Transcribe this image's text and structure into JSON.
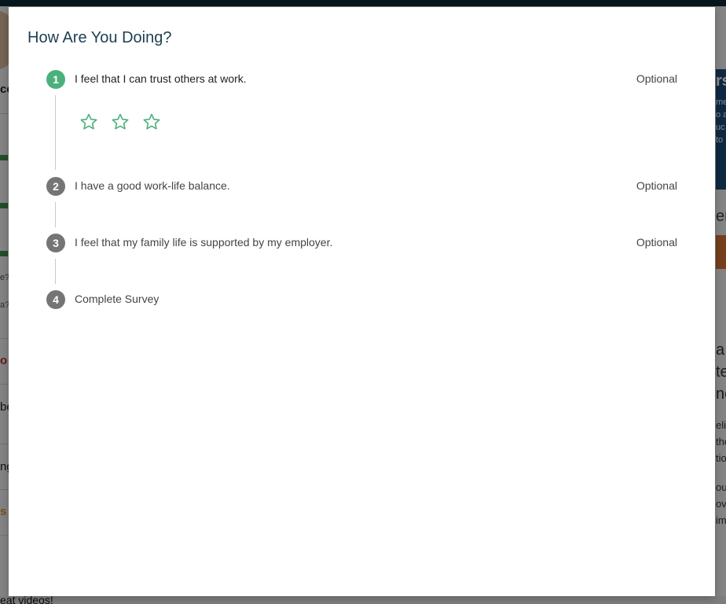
{
  "background": {
    "left_fragments": [
      "ce",
      "e?",
      "a?",
      "o",
      "be",
      "ng",
      "s",
      "eat videos!"
    ],
    "right_fragments": [
      "rs",
      "me",
      "o a",
      "uc",
      "to",
      "er",
      "a",
      "te",
      "ne",
      "elir",
      "the",
      "tio",
      "ou",
      "ovi",
      "im"
    ]
  },
  "survey": {
    "title": "How Are You Doing?",
    "steps": [
      {
        "number": "1",
        "label": "I feel that I can trust others at work.",
        "optional": "Optional",
        "active": true
      },
      {
        "number": "2",
        "label": "I have a good work-life balance.",
        "optional": "Optional",
        "active": false
      },
      {
        "number": "3",
        "label": "I feel that my family life is supported by my employer.",
        "optional": "Optional",
        "active": false
      },
      {
        "number": "4",
        "label": "Complete Survey",
        "active": false
      }
    ],
    "rating": {
      "icon": "star-outline-icon",
      "max": 3,
      "value": 0,
      "color": "#4bb17c"
    },
    "colors": {
      "active_step": "#4bb17c",
      "inactive_step": "#757575",
      "title": "#1d3e52"
    }
  }
}
